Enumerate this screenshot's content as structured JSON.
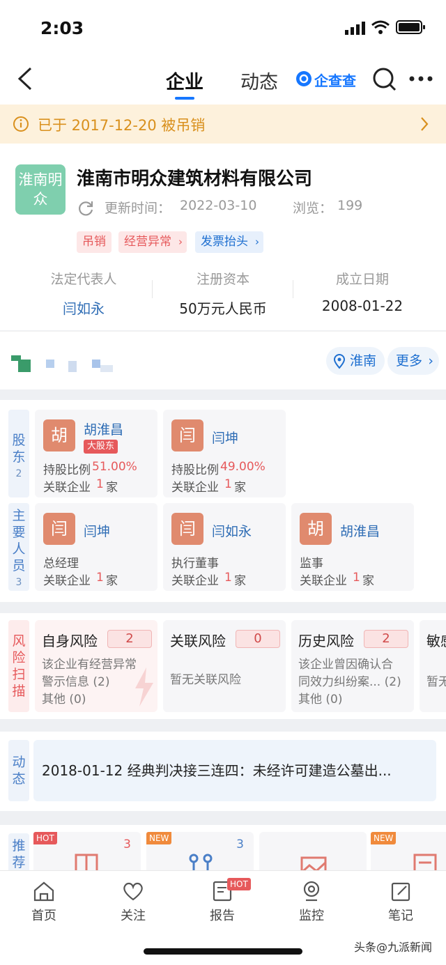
{
  "status": {
    "time": "2:03"
  },
  "nav": {
    "tabs": [
      {
        "label": "企业"
      },
      {
        "label": "动态"
      }
    ],
    "brand": "企查查"
  },
  "banner": {
    "text": "已于 2017-12-20 被吊销"
  },
  "company": {
    "logo_text": "淮南明众",
    "name": "淮南市明众建筑材料有限公司",
    "update_label": "更新时间：",
    "update_time": "2022-03-10",
    "views_label": "浏览：",
    "views": "199",
    "tags": [
      "吊销",
      "经营异常",
      "发票抬头"
    ],
    "info": [
      {
        "label": "法定代表人",
        "value": "闫如永"
      },
      {
        "label": "注册资本",
        "value": "50万元人民币"
      },
      {
        "label": "成立日期",
        "value": "2008-01-22"
      }
    ]
  },
  "address": {
    "location": "淮南",
    "more": "更多"
  },
  "shareholders": {
    "label": "股东",
    "count": "2",
    "items": [
      {
        "avatar": "胡",
        "name": "胡淮昌",
        "badge": "大股东",
        "ratio_label": "持股比例",
        "ratio": "51.00%",
        "related_label": "关联企业",
        "related": "1",
        "unit": "家"
      },
      {
        "avatar": "闫",
        "name": "闫坤",
        "ratio_label": "持股比例",
        "ratio": "49.00%",
        "related_label": "关联企业",
        "related": "1",
        "unit": "家"
      }
    ]
  },
  "staff": {
    "label": "主要人员",
    "count": "3",
    "items": [
      {
        "avatar": "闫",
        "name": "闫坤",
        "role": "总经理",
        "related_label": "关联企业",
        "related": "1",
        "unit": "家"
      },
      {
        "avatar": "闫",
        "name": "闫如永",
        "role": "执行董事",
        "related_label": "关联企业",
        "related": "1",
        "unit": "家"
      },
      {
        "avatar": "胡",
        "name": "胡淮昌",
        "role": "监事",
        "related_label": "关联企业",
        "related": "1",
        "unit": "家"
      }
    ]
  },
  "risk": {
    "label": "风险扫描",
    "items": [
      {
        "title": "自身风险",
        "count": "2",
        "line1": "该企业有经营异常",
        "line2": "警示信息 (2)",
        "line3": "其他 (0)"
      },
      {
        "title": "关联风险",
        "count": "0",
        "line1": "暂无关联风险",
        "line2": "",
        "line3": ""
      },
      {
        "title": "历史风险",
        "count": "2",
        "line1": "该企业曾因确认合",
        "line2": "同效力纠纷案... (2)",
        "line3": "其他 (0)"
      },
      {
        "title": "敏感",
        "count": "",
        "line1": "暂无",
        "line2": "",
        "line3": ""
      }
    ]
  },
  "dynamics": {
    "label": "动态",
    "text": "2018-01-12 经典判决接三连四：未经许可建造公墓出..."
  },
  "recommend": {
    "label": "推荐",
    "items": [
      {
        "tag": "HOT",
        "count": "3"
      },
      {
        "tag": "NEW",
        "count": "3"
      },
      {
        "tag": "",
        "count": ""
      },
      {
        "tag": "NEW",
        "count": ""
      }
    ]
  },
  "bottom_nav": {
    "items": [
      {
        "label": "首页"
      },
      {
        "label": "关注"
      },
      {
        "label": "报告"
      },
      {
        "label": "监控"
      },
      {
        "label": "笔记"
      }
    ],
    "report_badge": "HOT"
  },
  "watermark": "头条@九派新闻",
  "colors": {
    "accent": "#1677ff",
    "warning": "#d9901d",
    "risk": "#e6595b",
    "logo": "#7fcfae"
  }
}
